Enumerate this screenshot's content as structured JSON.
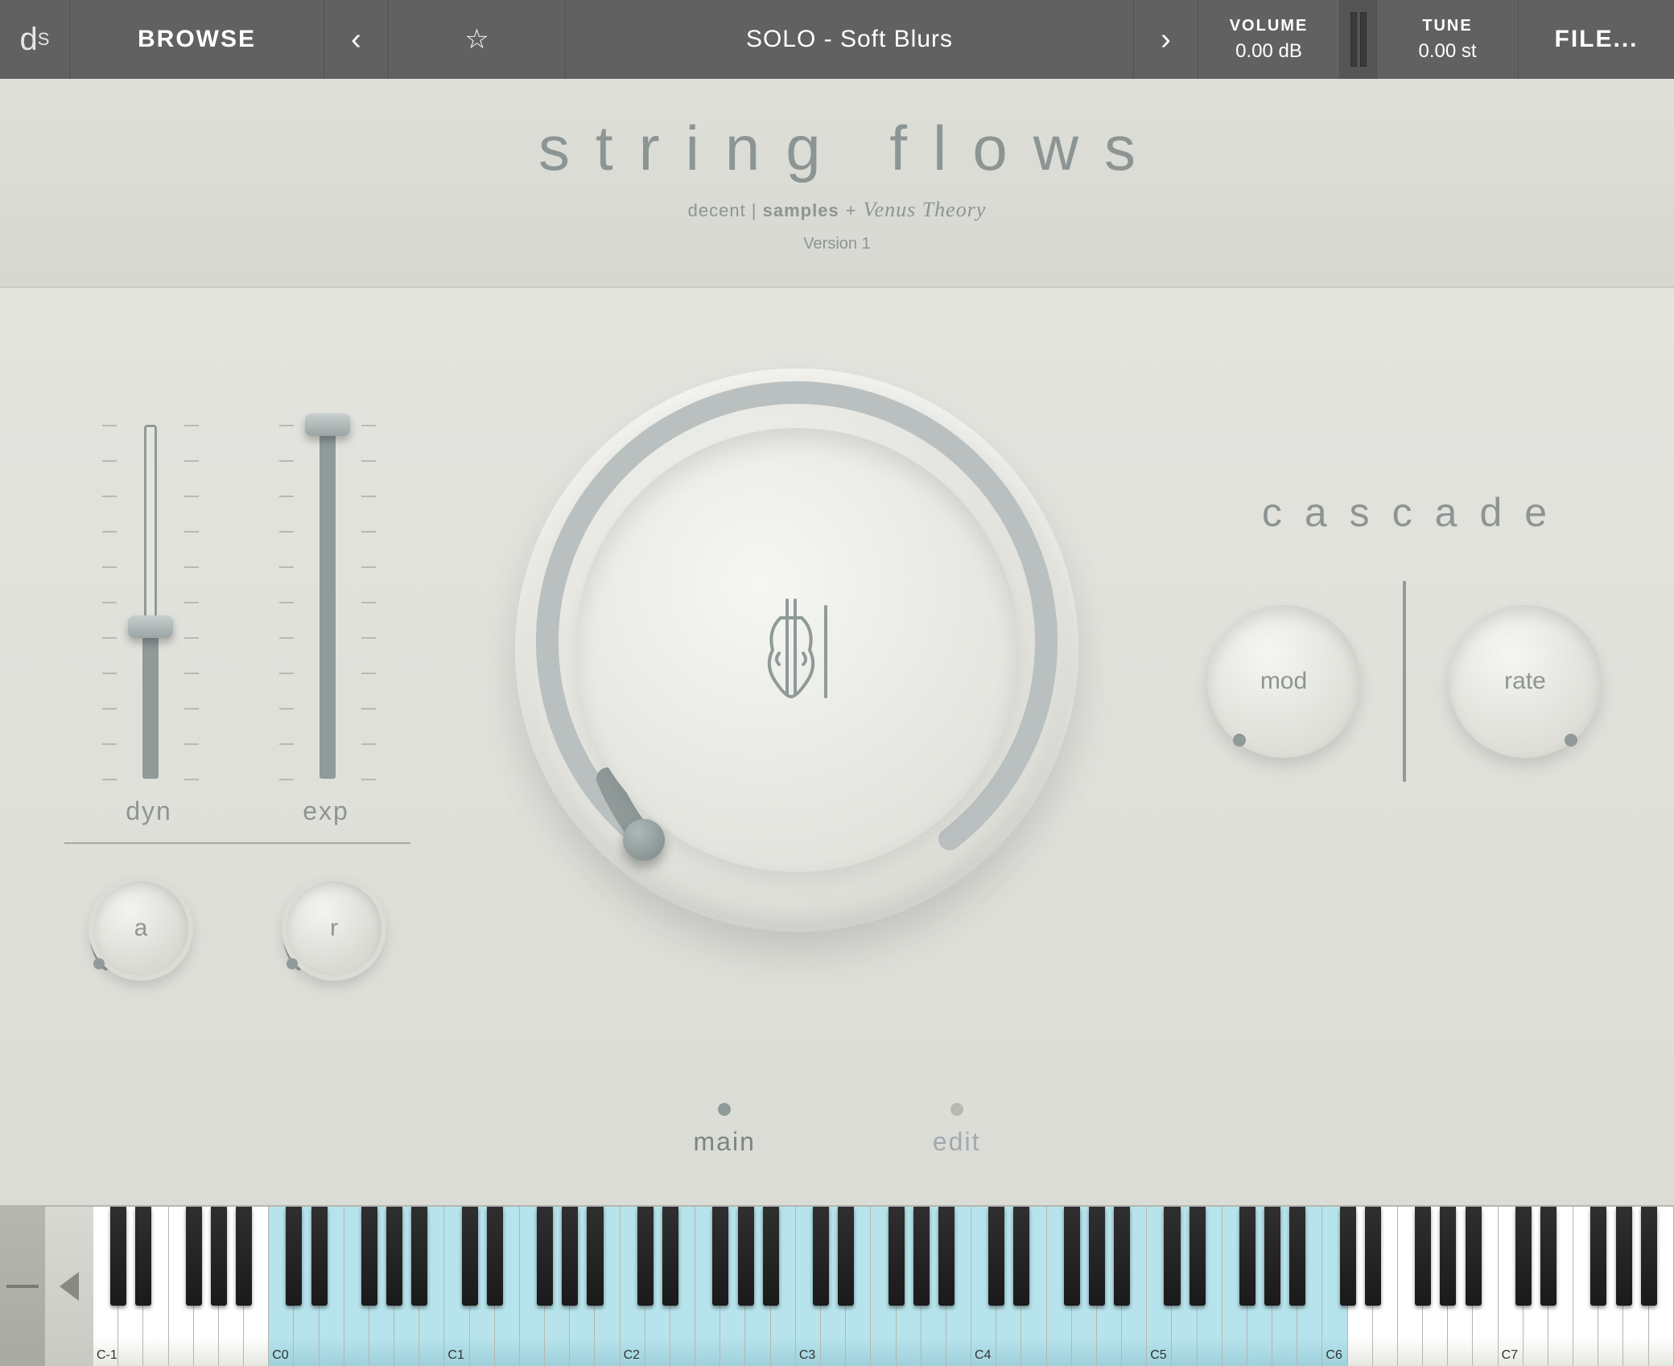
{
  "top": {
    "logo": "d",
    "logo_sub": "S",
    "browse": "BROWSE",
    "prev": "‹",
    "next": "›",
    "star": "☆",
    "preset": "SOLO - Soft Blurs",
    "volume_label": "VOLUME",
    "volume_value": "0.00 dB",
    "tune_label": "TUNE",
    "tune_value": "0.00 st",
    "file": "FILE..."
  },
  "banner": {
    "title": "string flows",
    "credits_pre": "decent | ",
    "credits_bold": "samples",
    "credits_plus": "+",
    "credits_vt": "Venus Theory",
    "version": "Version 1"
  },
  "sliders": {
    "dyn": {
      "label": "dyn",
      "value_pct": 43
    },
    "exp": {
      "label": "exp",
      "value_pct": 100
    }
  },
  "knobs": {
    "a": {
      "label": "a"
    },
    "r": {
      "label": "r"
    },
    "mod": {
      "label": "mod"
    },
    "rate": {
      "label": "rate"
    }
  },
  "cascade": {
    "title": "cascade"
  },
  "tabs": {
    "main": "main",
    "edit": "edit",
    "active": "main"
  },
  "keyboard": {
    "first_octave": -1,
    "last_octave": 7,
    "mapped_start": "C0",
    "mapped_end": "C6",
    "labels": [
      "C-1",
      "C0",
      "C1",
      "C2",
      "C3",
      "C4",
      "C5",
      "C6",
      "C7"
    ]
  }
}
